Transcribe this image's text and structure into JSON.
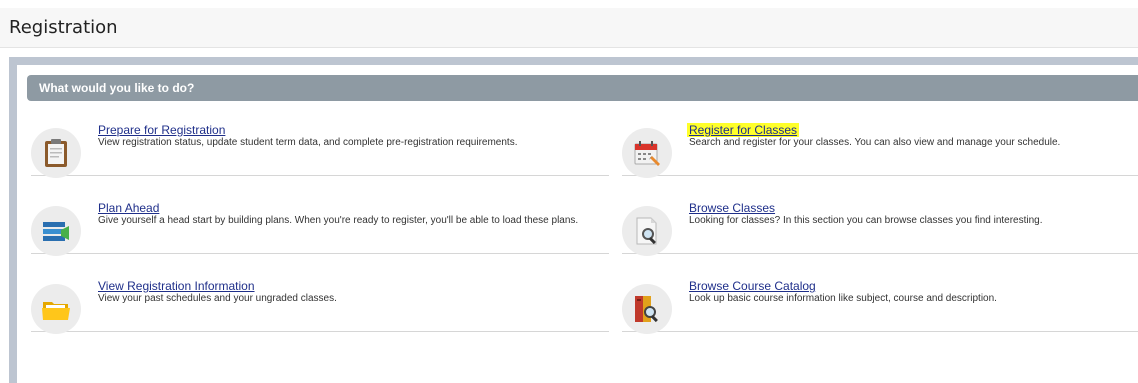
{
  "page": {
    "title": "Registration"
  },
  "panel": {
    "title": "What would you like to do?"
  },
  "actions": {
    "prepare": {
      "label": "Prepare for Registration",
      "description": "View registration status, update student term data, and complete pre-registration requirements.",
      "icon": "clipboard-icon"
    },
    "register": {
      "label": "Register for Classes",
      "description": "Search and register for your classes. You can also view and manage your schedule.",
      "icon": "calendar-pencil-icon",
      "highlight_color": "#ffff2a"
    },
    "plan": {
      "label": "Plan Ahead",
      "description": "Give yourself a head start by building plans. When you're ready to register, you'll be able to load these plans.",
      "icon": "plan-list-icon"
    },
    "browse_classes": {
      "label": "Browse Classes",
      "description": "Looking for classes? In this section you can browse classes you find interesting.",
      "icon": "document-search-icon"
    },
    "view_info": {
      "label": "View Registration Information",
      "description": "View your past schedules and your ungraded classes.",
      "icon": "folder-icon"
    },
    "catalog": {
      "label": "Browse Course Catalog",
      "description": "Look up basic course information like subject, course and description.",
      "icon": "book-search-icon"
    }
  },
  "colors": {
    "link": "#1f2f8a",
    "panel_bar": "#8e9aa3",
    "outer_frame": "#bdc5d1"
  }
}
